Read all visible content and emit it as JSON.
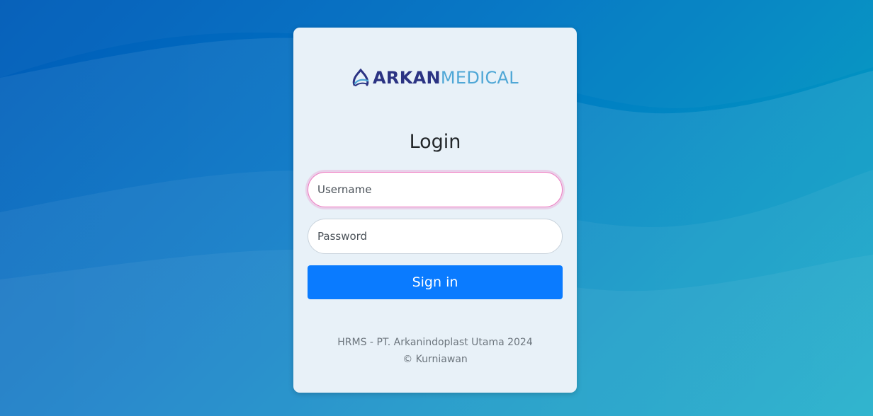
{
  "logo": {
    "brand_primary": "ARKAN",
    "brand_secondary": "MEDICAL",
    "icon": "arkan-medical-logo-icon",
    "primary_color": "#2b3383",
    "secondary_color": "#4fa7d6"
  },
  "login": {
    "title": "Login",
    "username_placeholder": "Username",
    "username_value": "",
    "password_placeholder": "Password",
    "password_value": "",
    "signin_label": "Sign in",
    "focus_color": "#ee7bc1",
    "button_color": "#0a7bff"
  },
  "footer": {
    "line1": "HRMS - PT. Arkanindoplast Utama 2024",
    "line2": "© Kurniawan"
  }
}
